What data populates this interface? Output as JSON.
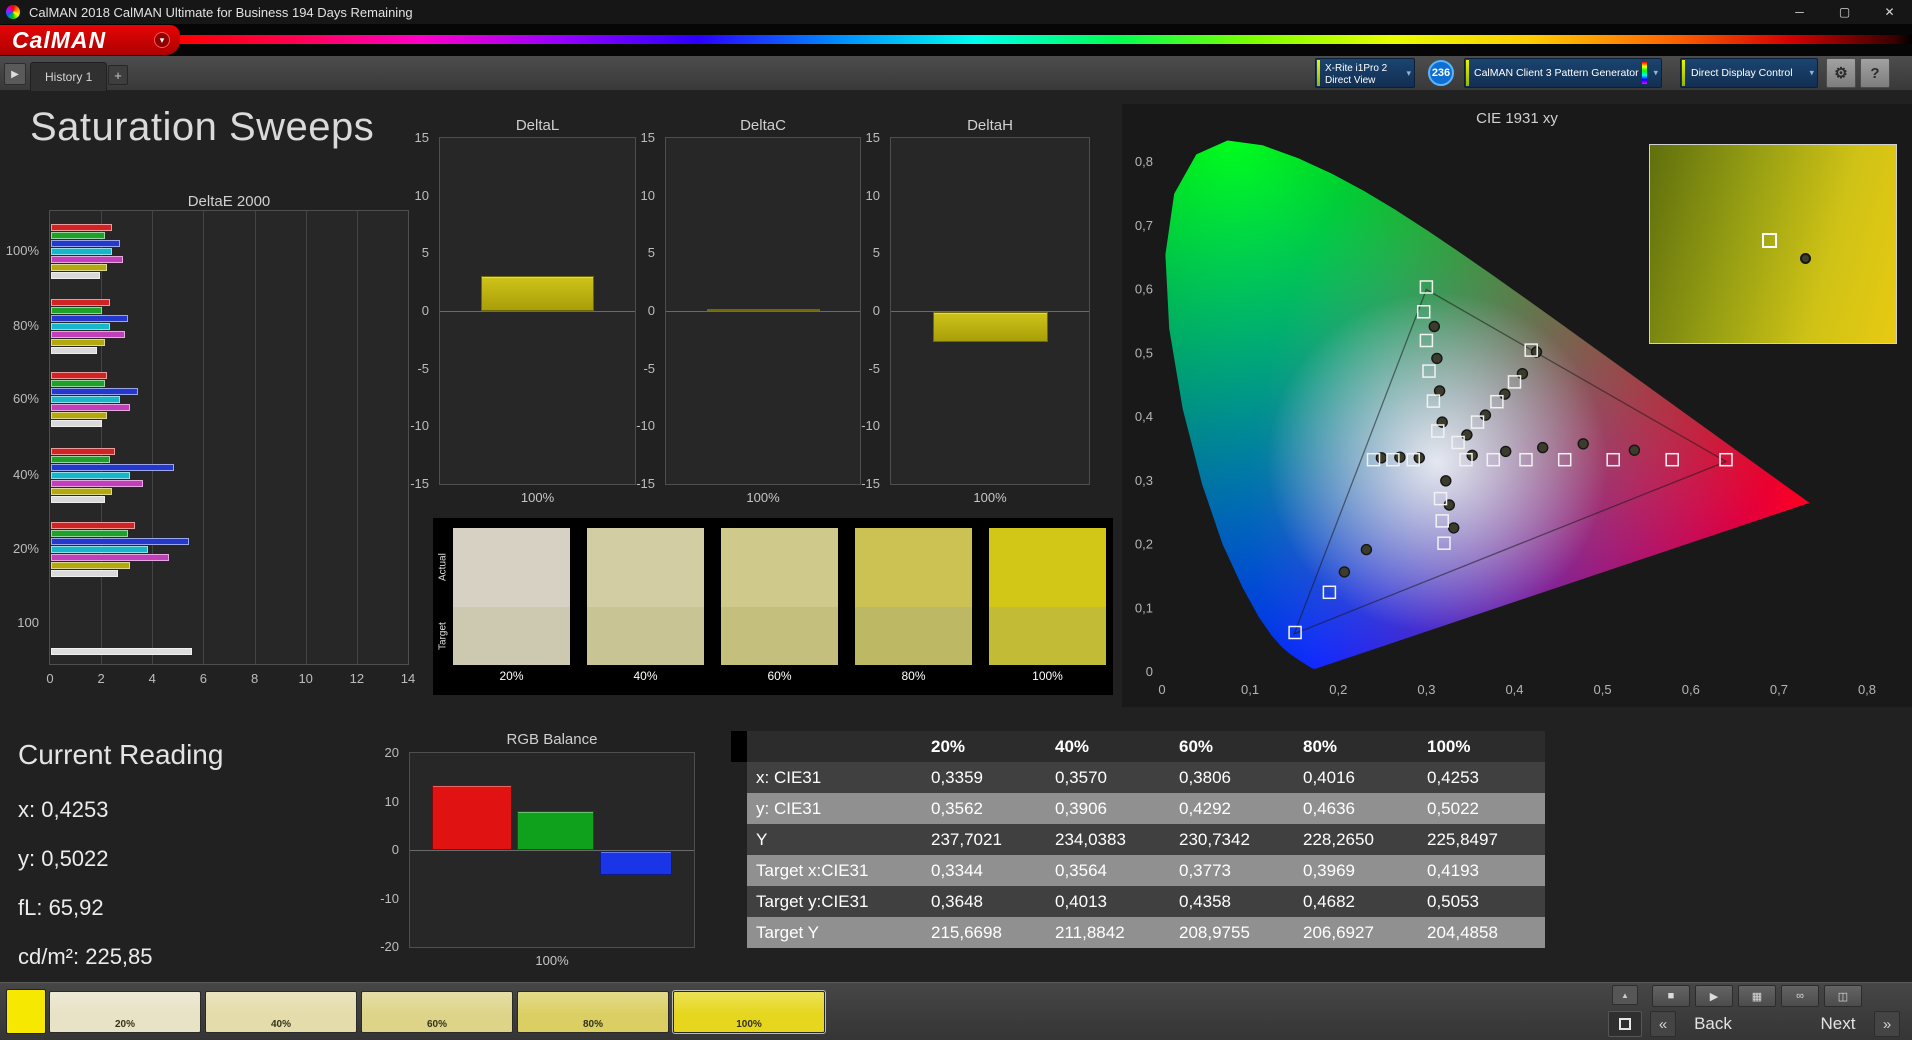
{
  "window": {
    "title": "CalMAN 2018 CalMAN Ultimate for Business 194 Days Remaining",
    "controls": {
      "minimize": "─",
      "maximize": "▢",
      "close": "✕"
    }
  },
  "brand": {
    "logo_text": "CalMAN"
  },
  "icons": {
    "dropdown": "▾",
    "settings": "⚙",
    "help": "?",
    "nav": "▶",
    "prev": "«",
    "next": "»",
    "up": "▲"
  },
  "tab_bar": {
    "tabs": [
      {
        "label": "History 1"
      }
    ],
    "add_tab": "+"
  },
  "device_bar": {
    "meter_button": {
      "line1": "X-Rite i1Pro 2",
      "line2": "Direct View"
    },
    "badge": "236",
    "pattern_button": "CalMAN Client 3 Pattern Generator",
    "display_button": "Direct Display Control"
  },
  "page": {
    "title": "Saturation Sweeps"
  },
  "current_reading": {
    "title": "Current Reading",
    "lines": [
      "x: 0,4253",
      "y: 0,5022",
      "fL: 65,92",
      "cd/m²: 225,85"
    ]
  },
  "swatch_strip": {
    "row_labels": [
      "Actual",
      "Target"
    ],
    "columns": [
      {
        "label": "20%",
        "actual": "#d7d1c3",
        "target": "#cdc8b0"
      },
      {
        "label": "40%",
        "actual": "#d3cda4",
        "target": "#c9c494"
      },
      {
        "label": "60%",
        "actual": "#cfc98b",
        "target": "#c5bf7d"
      },
      {
        "label": "80%",
        "actual": "#ccc254",
        "target": "#bdb863"
      },
      {
        "label": "100%",
        "actual": "#d2c616",
        "target": "#c2bb35"
      }
    ]
  },
  "results_table": {
    "columns": [
      "20%",
      "40%",
      "60%",
      "80%",
      "100%"
    ],
    "rows": [
      {
        "label": "x: CIE31",
        "values": [
          "0,3359",
          "0,3570",
          "0,3806",
          "0,4016",
          "0,4253"
        ]
      },
      {
        "label": "y: CIE31",
        "values": [
          "0,3562",
          "0,3906",
          "0,4292",
          "0,4636",
          "0,5022"
        ]
      },
      {
        "label": "Y",
        "values": [
          "237,7021",
          "234,0383",
          "230,7342",
          "228,2650",
          "225,8497"
        ]
      },
      {
        "label": "Target x:CIE31",
        "values": [
          "0,3344",
          "0,3564",
          "0,3773",
          "0,3969",
          "0,4193"
        ]
      },
      {
        "label": "Target y:CIE31",
        "values": [
          "0,3648",
          "0,4013",
          "0,4358",
          "0,4682",
          "0,5053"
        ]
      },
      {
        "label": "Target Y",
        "values": [
          "215,6698",
          "211,8842",
          "208,9755",
          "206,6927",
          "204,4858"
        ]
      }
    ]
  },
  "bottom_bar": {
    "current_patch_color": "#f6e800",
    "patches": [
      {
        "label": "20%",
        "color": "#e8e2c6"
      },
      {
        "label": "40%",
        "color": "#e4dcaa"
      },
      {
        "label": "60%",
        "color": "#ded489"
      },
      {
        "label": "80%",
        "color": "#dbcf63"
      },
      {
        "label": "100%",
        "color": "#e6d71e",
        "selected": true
      }
    ],
    "session_buttons": [
      {
        "icon": "■",
        "name": "stop-button"
      },
      {
        "icon": "▶",
        "name": "run-button"
      },
      {
        "icon": "▦",
        "name": "save-button"
      },
      {
        "icon": "∞",
        "name": "continuous-button"
      },
      {
        "icon": "◫",
        "name": "compare-button"
      }
    ],
    "nav": {
      "back": "Back",
      "next": "Next"
    }
  },
  "chart_data": [
    {
      "id": "deltae2000",
      "type": "bar",
      "orientation": "horizontal",
      "title": "DeltaE 2000",
      "xlim": [
        0,
        14
      ],
      "x_ticks": [
        0,
        2,
        4,
        6,
        8,
        10,
        12,
        14
      ],
      "groups": [
        {
          "label": "100%",
          "bars": [
            {
              "color": "#d02424",
              "value": 2.4
            },
            {
              "color": "#1fa02a",
              "value": 2.1
            },
            {
              "color": "#2438cc",
              "value": 2.7
            },
            {
              "color": "#17b6c8",
              "value": 2.4
            },
            {
              "color": "#c23fba",
              "value": 2.8
            },
            {
              "color": "#b3a90f",
              "value": 2.2
            },
            {
              "color": "#d9d9d9",
              "value": 1.9
            }
          ]
        },
        {
          "label": "80%",
          "bars": [
            {
              "color": "#d02424",
              "value": 2.3
            },
            {
              "color": "#1fa02a",
              "value": 2.0
            },
            {
              "color": "#2438cc",
              "value": 3.0
            },
            {
              "color": "#17b6c8",
              "value": 2.3
            },
            {
              "color": "#c23fba",
              "value": 2.9
            },
            {
              "color": "#b3a90f",
              "value": 2.1
            },
            {
              "color": "#d9d9d9",
              "value": 1.8
            }
          ]
        },
        {
          "label": "60%",
          "bars": [
            {
              "color": "#d02424",
              "value": 2.2
            },
            {
              "color": "#1fa02a",
              "value": 2.1
            },
            {
              "color": "#2438cc",
              "value": 3.4
            },
            {
              "color": "#17b6c8",
              "value": 2.7
            },
            {
              "color": "#c23fba",
              "value": 3.1
            },
            {
              "color": "#b3a90f",
              "value": 2.2
            },
            {
              "color": "#d9d9d9",
              "value": 2.0
            }
          ]
        },
        {
          "label": "40%",
          "bars": [
            {
              "color": "#d02424",
              "value": 2.5
            },
            {
              "color": "#1fa02a",
              "value": 2.3
            },
            {
              "color": "#2438cc",
              "value": 4.8
            },
            {
              "color": "#17b6c8",
              "value": 3.1
            },
            {
              "color": "#c23fba",
              "value": 3.6
            },
            {
              "color": "#b3a90f",
              "value": 2.4
            },
            {
              "color": "#d9d9d9",
              "value": 2.1
            }
          ]
        },
        {
          "label": "20%",
          "bars": [
            {
              "color": "#d02424",
              "value": 3.3
            },
            {
              "color": "#1fa02a",
              "value": 3.0
            },
            {
              "color": "#2438cc",
              "value": 5.4
            },
            {
              "color": "#17b6c8",
              "value": 3.8
            },
            {
              "color": "#c23fba",
              "value": 4.6
            },
            {
              "color": "#b3a90f",
              "value": 3.1
            },
            {
              "color": "#d9d9d9",
              "value": 2.6
            }
          ]
        },
        {
          "label": "100",
          "bars": [
            {
              "color": "#dddddd",
              "value": 5.5
            }
          ]
        }
      ]
    },
    {
      "id": "deltaL",
      "type": "bar",
      "title": "DeltaL",
      "ylim": [
        -15,
        15
      ],
      "y_ticks": [
        15,
        10,
        5,
        0,
        -5,
        -10,
        -15
      ],
      "categories": [
        "100%"
      ],
      "values": [
        3.0
      ],
      "bar_color": "#b9ae12"
    },
    {
      "id": "deltaC",
      "type": "bar",
      "title": "DeltaC",
      "ylim": [
        -15,
        15
      ],
      "y_ticks": [
        15,
        10,
        5,
        0,
        -5,
        -10,
        -15
      ],
      "categories": [
        "100%"
      ],
      "values": [
        0.2
      ],
      "bar_color": "#b9ae12"
    },
    {
      "id": "deltaH",
      "type": "bar",
      "title": "DeltaH",
      "ylim": [
        -15,
        15
      ],
      "y_ticks": [
        15,
        10,
        5,
        0,
        -5,
        -10,
        -15
      ],
      "categories": [
        "100%"
      ],
      "values": [
        -2.6
      ],
      "bar_color": "#b9ae12"
    },
    {
      "id": "rgb_balance",
      "type": "bar",
      "title": "RGB Balance",
      "ylim": [
        -20,
        20
      ],
      "y_ticks": [
        20,
        10,
        0,
        -10,
        -20
      ],
      "categories": [
        "100%"
      ],
      "series": [
        {
          "name": "Red",
          "color": "#e01212",
          "value": 13.5
        },
        {
          "name": "Green",
          "color": "#0fa01c",
          "value": 8
        },
        {
          "name": "Blue",
          "color": "#1a35e8",
          "value": -5
        }
      ]
    },
    {
      "id": "cie1931",
      "type": "scatter",
      "title": "CIE 1931 xy",
      "xlim": [
        0,
        0.8
      ],
      "ylim": [
        0,
        0.8
      ],
      "x_ticks": [
        "0",
        "0,1",
        "0,2",
        "0,3",
        "0,4",
        "0,5",
        "0,6",
        "0,7",
        "0,8"
      ],
      "y_ticks": [
        "0",
        "0,1",
        "0,2",
        "0,3",
        "0,4",
        "0,5",
        "0,6",
        "0,7",
        "0,8"
      ],
      "gamut_triangle": [
        [
          0.64,
          0.33
        ],
        [
          0.3,
          0.6
        ],
        [
          0.15,
          0.06
        ]
      ],
      "target_points": [
        [
          0.24,
          0.333
        ],
        [
          0.262,
          0.333
        ],
        [
          0.285,
          0.333
        ],
        [
          0.345,
          0.333
        ],
        [
          0.376,
          0.333
        ],
        [
          0.413,
          0.333
        ],
        [
          0.457,
          0.333
        ],
        [
          0.512,
          0.333
        ],
        [
          0.579,
          0.333
        ],
        [
          0.64,
          0.333
        ],
        [
          0.313,
          0.378
        ],
        [
          0.308,
          0.425
        ],
        [
          0.303,
          0.472
        ],
        [
          0.3,
          0.52
        ],
        [
          0.297,
          0.565
        ],
        [
          0.3,
          0.604
        ],
        [
          0.316,
          0.272
        ],
        [
          0.318,
          0.237
        ],
        [
          0.32,
          0.202
        ],
        [
          0.19,
          0.125
        ],
        [
          0.151,
          0.062
        ],
        [
          0.336,
          0.36
        ],
        [
          0.358,
          0.392
        ],
        [
          0.38,
          0.424
        ],
        [
          0.4,
          0.455
        ],
        [
          0.419,
          0.505
        ]
      ],
      "measured_points": [
        [
          0.352,
          0.34
        ],
        [
          0.39,
          0.346
        ],
        [
          0.432,
          0.352
        ],
        [
          0.478,
          0.358
        ],
        [
          0.536,
          0.348
        ],
        [
          0.292,
          0.336
        ],
        [
          0.27,
          0.337
        ],
        [
          0.249,
          0.336
        ],
        [
          0.318,
          0.392
        ],
        [
          0.315,
          0.441
        ],
        [
          0.312,
          0.492
        ],
        [
          0.309,
          0.542
        ],
        [
          0.322,
          0.3
        ],
        [
          0.326,
          0.262
        ],
        [
          0.331,
          0.226
        ],
        [
          0.232,
          0.192
        ],
        [
          0.207,
          0.157
        ],
        [
          0.346,
          0.372
        ],
        [
          0.367,
          0.403
        ],
        [
          0.389,
          0.436
        ],
        [
          0.409,
          0.468
        ],
        [
          0.425,
          0.502
        ]
      ]
    }
  ]
}
